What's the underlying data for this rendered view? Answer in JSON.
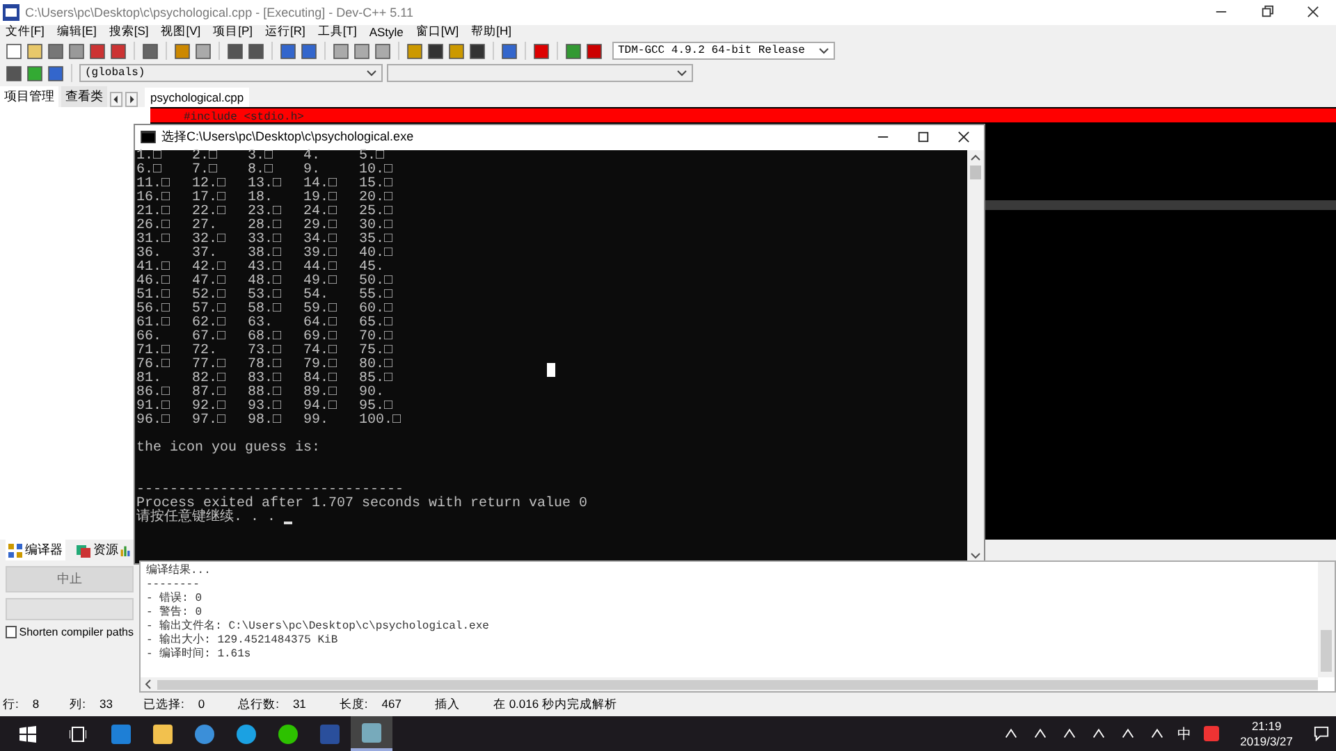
{
  "window": {
    "title": "C:\\Users\\pc\\Desktop\\c\\psychological.cpp - [Executing] - Dev-C++ 5.11"
  },
  "menu": [
    "文件[F]",
    "编辑[E]",
    "搜索[S]",
    "视图[V]",
    "项目[P]",
    "运行[R]",
    "工具[T]",
    "AStyle",
    "窗口[W]",
    "帮助[H]"
  ],
  "compiler_select": {
    "value": "TDM-GCC 4.9.2 64-bit Release"
  },
  "scope_select": {
    "value": "(globals)"
  },
  "left_tabs": [
    {
      "label": "项目管理",
      "selected": true
    },
    {
      "label": "查看类",
      "selected": false
    }
  ],
  "editor_tabs": [
    {
      "label": "psychological.cpp",
      "selected": true
    }
  ],
  "editor": {
    "visible_line": "#include <stdio.h>"
  },
  "console": {
    "title": "选择C:\\Users\\pc\\Desktop\\c\\psychological.exe",
    "grid_rows": [
      [
        "1.□",
        "2.□",
        "3.□",
        "4.",
        "5.□"
      ],
      [
        "6.□",
        "7.□",
        "8.□",
        "9.",
        "10.□"
      ],
      [
        "11.□",
        "12.□",
        "13.□",
        "14.□",
        "15.□"
      ],
      [
        "16.□",
        "17.□",
        "18.",
        "19.□",
        "20.□"
      ],
      [
        "21.□",
        "22.□",
        "23.□",
        "24.□",
        "25.□"
      ],
      [
        "26.□",
        "27.",
        "28.□",
        "29.□",
        "30.□"
      ],
      [
        "31.□",
        "32.□",
        "33.□",
        "34.□",
        "35.□"
      ],
      [
        "36.",
        "37.",
        "38.□",
        "39.□",
        "40.□"
      ],
      [
        "41.□",
        "42.□",
        "43.□",
        "44.□",
        "45."
      ],
      [
        "46.□",
        "47.□",
        "48.□",
        "49.□",
        "50.□"
      ],
      [
        "51.□",
        "52.□",
        "53.□",
        "54.",
        "55.□"
      ],
      [
        "56.□",
        "57.□",
        "58.□",
        "59.□",
        "60.□"
      ],
      [
        "61.□",
        "62.□",
        "63.",
        "64.□",
        "65.□"
      ],
      [
        "66.",
        "67.□",
        "68.□",
        "69.□",
        "70.□"
      ],
      [
        "71.□",
        "72.",
        "73.□",
        "74.□",
        "75.□"
      ],
      [
        "76.□",
        "77.□",
        "78.□",
        "79.□",
        "80.□"
      ],
      [
        "81.",
        "82.□",
        "83.□",
        "84.□",
        "85.□"
      ],
      [
        "86.□",
        "87.□",
        "88.□",
        "89.□",
        "90."
      ],
      [
        "91.□",
        "92.□",
        "93.□",
        "94.□",
        "95.□"
      ],
      [
        "96.□",
        "97.□",
        "98.□",
        "99.",
        "100.□"
      ]
    ],
    "prompt": "the icon you guess is:",
    "separator": "--------------------------------",
    "exit_message": "Process exited after 1.707 seconds with return value 0",
    "continue_prompt": "请按任意键继续. . . "
  },
  "bottom_tabs": [
    {
      "label": "编译器",
      "selected": true
    },
    {
      "label": "资源",
      "selected": false
    }
  ],
  "abort_button": {
    "label": "中止",
    "disabled": true
  },
  "shorten_paths": {
    "label": "Shorten compiler paths",
    "checked": false
  },
  "compile_log": [
    "编译结果...",
    "--------",
    "- 错误: 0",
    "- 警告: 0",
    "- 输出文件名: C:\\Users\\pc\\Desktop\\c\\psychological.exe",
    "- 输出大小: 129.4521484375 KiB",
    "- 编译时间: 1.61s"
  ],
  "status_bar": [
    {
      "label": "行:",
      "value": "8"
    },
    {
      "label": "列:",
      "value": "33"
    },
    {
      "label": "已选择:",
      "value": "0"
    },
    {
      "label": "总行数:",
      "value": "31"
    },
    {
      "label": "长度:",
      "value": "467"
    },
    {
      "label": "插入"
    },
    {
      "label": "在 0.016 秒内完成解析"
    }
  ],
  "taskbar": {
    "ime": "中",
    "time": "21:19",
    "date": "2019/3/27"
  }
}
